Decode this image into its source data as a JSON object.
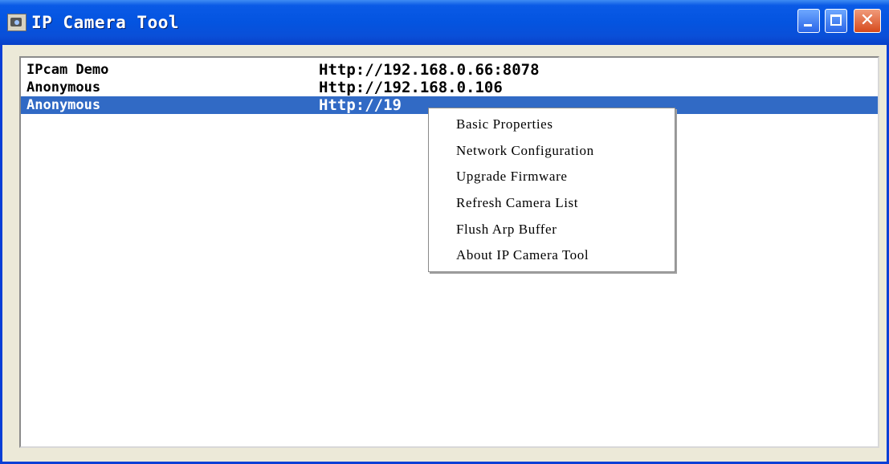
{
  "window": {
    "title": "IP Camera Tool",
    "controls": [
      "minimize",
      "maximize",
      "close"
    ],
    "close_glyph": "✕"
  },
  "camera_list": {
    "rows": [
      {
        "name": "IPcam Demo",
        "url": "Http://192.168.0.66:8078",
        "selected": false
      },
      {
        "name": "Anonymous",
        "url": "Http://192.168.0.106",
        "selected": false
      },
      {
        "name": "Anonymous",
        "url": "Http://19",
        "selected": true
      }
    ]
  },
  "context_menu": {
    "items": [
      {
        "label": "Basic Properties"
      },
      {
        "label": "Network Configuration"
      },
      {
        "label": "Upgrade Firmware"
      },
      {
        "label": "Refresh Camera List"
      },
      {
        "label": "Flush Arp Buffer"
      },
      {
        "label": "About IP Camera Tool"
      }
    ]
  },
  "colors": {
    "titlebar": "#0454e0",
    "selection": "#316ac5",
    "close_button": "#d64a1c",
    "window_face": "#ece9d8"
  }
}
